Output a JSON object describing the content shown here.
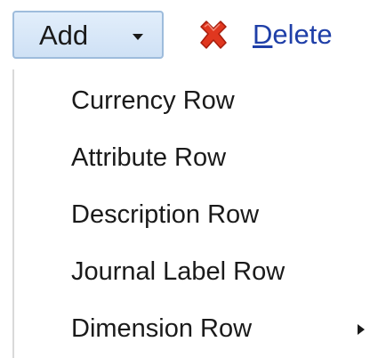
{
  "toolbar": {
    "add": {
      "label": "Add",
      "icon": "chevron-down-icon"
    },
    "delete": {
      "label_first": "D",
      "label_rest": "elete",
      "icon": "delete-x-icon",
      "icon_color": "#e0371f",
      "label_color": "#1f3fa8"
    }
  },
  "menu": {
    "items": [
      {
        "label": "Currency Row"
      },
      {
        "label": "Attribute Row"
      },
      {
        "label": "Description Row"
      },
      {
        "label": "Journal Label Row"
      },
      {
        "label": "Dimension Row",
        "has_submenu": true,
        "submenu_icon": "chevron-right-icon"
      }
    ]
  }
}
